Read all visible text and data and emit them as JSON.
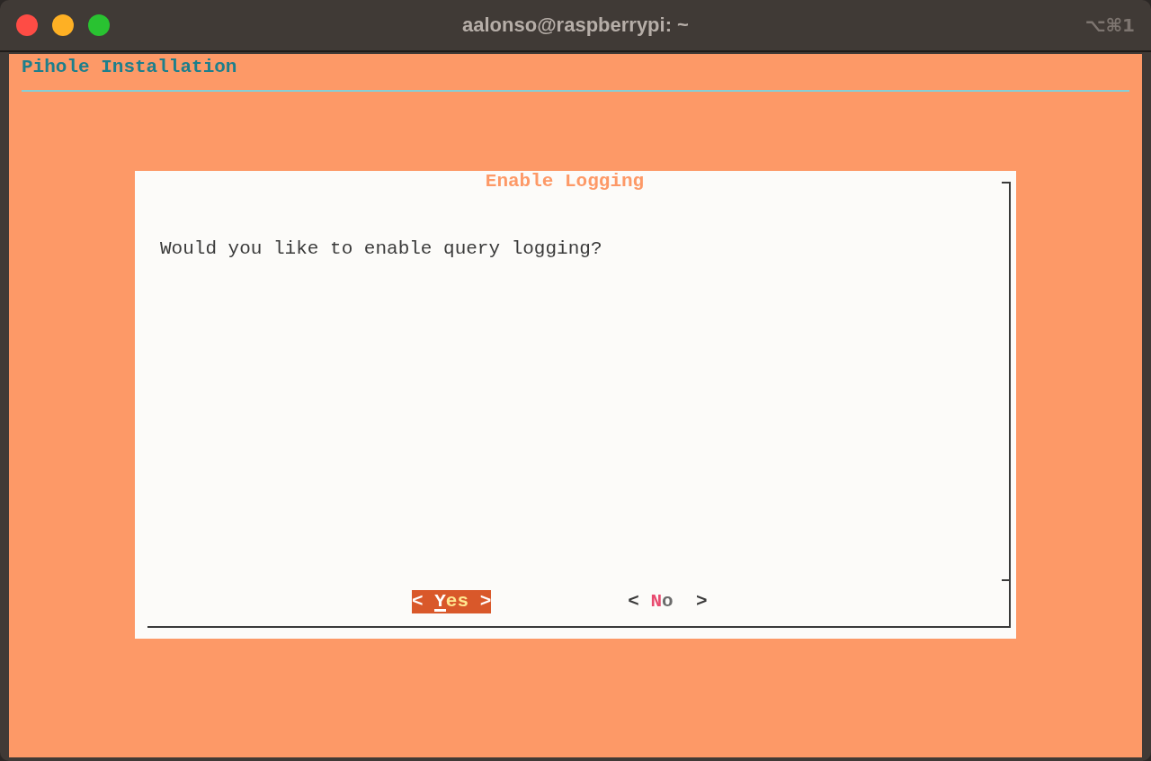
{
  "window": {
    "title": "aalonso@raspberrypi: ~",
    "shortcut": "⌥⌘1"
  },
  "backtitle": "Pihole Installation",
  "dialog": {
    "title": "Enable Logging",
    "message": "Would you like to enable query logging?",
    "buttons": [
      {
        "open": "<",
        "hotkey": "Y",
        "rest": "es",
        "close": ">",
        "selected": true
      },
      {
        "open": "<",
        "hotkey": "N",
        "rest": "o",
        "close": ">",
        "selected": false
      }
    ]
  }
}
